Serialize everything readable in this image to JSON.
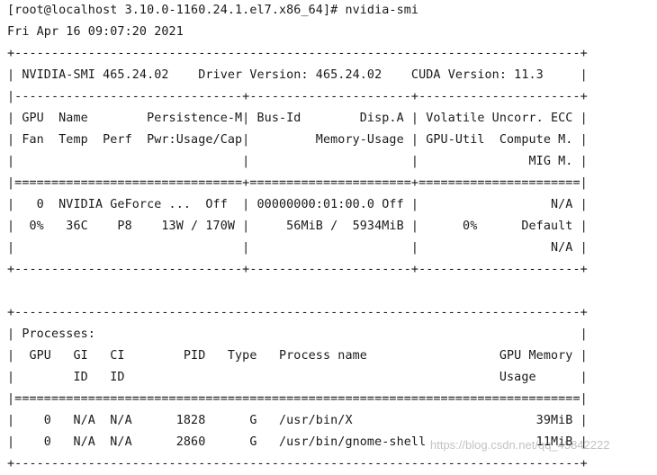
{
  "terminal": {
    "lines": [
      "[root@localhost 3.10.0-1160.24.1.el7.x86_64]# nvidia-smi",
      "Fri Apr 16 09:07:20 2021",
      "+-----------------------------------------------------------------------------+",
      "| NVIDIA-SMI 465.24.02    Driver Version: 465.24.02    CUDA Version: 11.3     |",
      "|-------------------------------+----------------------+----------------------+",
      "| GPU  Name        Persistence-M| Bus-Id        Disp.A | Volatile Uncorr. ECC |",
      "| Fan  Temp  Perf  Pwr:Usage/Cap|         Memory-Usage | GPU-Util  Compute M. |",
      "|                               |                      |               MIG M. |",
      "|===============================+======================+======================|",
      "|   0  NVIDIA GeForce ...  Off  | 00000000:01:00.0 Off |                  N/A |",
      "|  0%   36C    P8    13W / 170W |     56MiB /  5934MiB |      0%      Default |",
      "|                               |                      |                  N/A |",
      "+-------------------------------+----------------------+----------------------+",
      "",
      "+-----------------------------------------------------------------------------+",
      "| Processes:                                                                  |",
      "|  GPU   GI   CI        PID   Type   Process name                  GPU Memory |",
      "|        ID   ID                                                   Usage      |",
      "|=============================================================================|",
      "|    0   N/A  N/A      1828      G   /usr/bin/X                         39MiB |",
      "|    0   N/A  N/A      2860      G   /usr/bin/gnome-shell               11MiB |",
      "+-----------------------------------------------------------------------------+"
    ],
    "watermark": "https://blog.csdn.net/qq_45842222"
  }
}
